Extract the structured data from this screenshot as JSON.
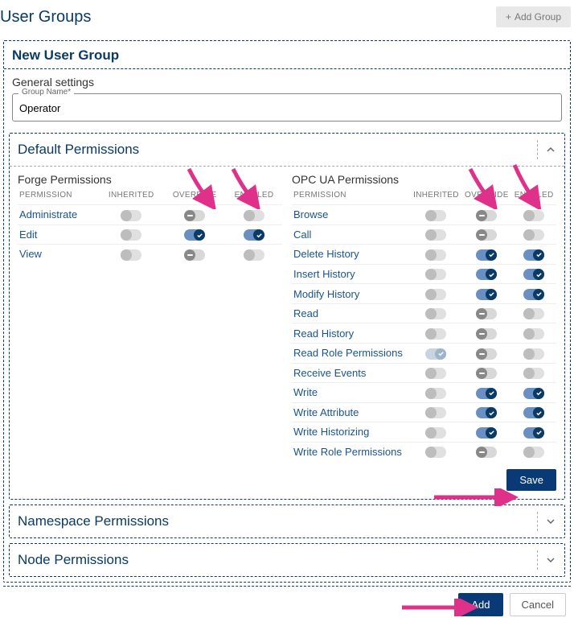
{
  "page": {
    "title": "User Groups",
    "addGroupLabel": "Add Group"
  },
  "newGroup": {
    "title": "New User Group",
    "generalSettings": "General settings",
    "groupNameLabel": "Group Name*",
    "groupNameValue": "Operator"
  },
  "sections": {
    "defaultPermissions": "Default Permissions",
    "namespacePermissions": "Namespace Permissions",
    "nodePermissions": "Node Permissions"
  },
  "columns": {
    "permission": "PERMISSION",
    "inherited": "INHERITED",
    "override": "OVERRIDE",
    "enabled": "ENABLED"
  },
  "forge": {
    "title": "Forge Permissions",
    "rows": [
      {
        "name": "Administrate",
        "inherited": "off_dis",
        "override": "dash_en",
        "enabled": "off_dis"
      },
      {
        "name": "Edit",
        "inherited": "off_dis",
        "override": "on_chk",
        "enabled": "on_chk"
      },
      {
        "name": "View",
        "inherited": "off_dis",
        "override": "dash_en",
        "enabled": "off_dis"
      }
    ]
  },
  "opcua": {
    "title": "OPC UA Permissions",
    "rows": [
      {
        "name": "Browse",
        "inherited": "off_dis",
        "override": "dash_en",
        "enabled": "off_dis"
      },
      {
        "name": "Call",
        "inherited": "off_dis",
        "override": "dash_en",
        "enabled": "off_dis"
      },
      {
        "name": "Delete History",
        "inherited": "off_dis",
        "override": "on_chk",
        "enabled": "on_chk"
      },
      {
        "name": "Insert History",
        "inherited": "off_dis",
        "override": "on_chk",
        "enabled": "on_chk"
      },
      {
        "name": "Modify History",
        "inherited": "off_dis",
        "override": "on_chk",
        "enabled": "on_chk"
      },
      {
        "name": "Read",
        "inherited": "off_dis",
        "override": "dash_en",
        "enabled": "off_dis"
      },
      {
        "name": "Read History",
        "inherited": "off_dis",
        "override": "dash_en",
        "enabled": "off_dis"
      },
      {
        "name": "Read Role Permissions",
        "inherited": "on_dis",
        "override": "dash_en",
        "enabled": "off_dis"
      },
      {
        "name": "Receive Events",
        "inherited": "off_dis",
        "override": "dash_en",
        "enabled": "off_dis"
      },
      {
        "name": "Write",
        "inherited": "off_dis",
        "override": "on_chk",
        "enabled": "on_chk"
      },
      {
        "name": "Write Attribute",
        "inherited": "off_dis",
        "override": "on_chk",
        "enabled": "on_chk"
      },
      {
        "name": "Write Historizing",
        "inherited": "off_dis",
        "override": "on_chk",
        "enabled": "on_chk"
      },
      {
        "name": "Write Role Permissions",
        "inherited": "off_dis",
        "override": "dash_en",
        "enabled": "off_dis"
      }
    ]
  },
  "buttons": {
    "save": "Save",
    "add": "Add",
    "cancel": "Cancel"
  }
}
